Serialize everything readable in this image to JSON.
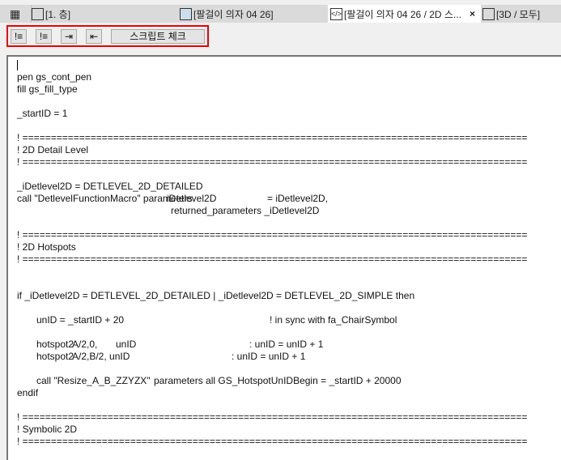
{
  "tabs": [
    {
      "label": "[1. 층]",
      "icon": "floor-plan-icon"
    },
    {
      "label": "[팔걸이 의자 04 26]",
      "icon": "object-icon"
    },
    {
      "label": "[팔걸이 의자 04 26 / 2D 스...",
      "icon": "script-icon",
      "close": "×"
    },
    {
      "label": "[3D / 모두]",
      "icon": "3d-icon"
    }
  ],
  "toolbar": {
    "script_check": "스크립트 체크"
  },
  "code": {
    "l1": "pen gs_cont_pen",
    "l2": "fill gs_fill_type",
    "l3": "_startID = 1",
    "sep": "! ==========================================================================================",
    "h1": "! 2D Detail Level",
    "l4": "_iDetlevel2D = DETLEVEL_2D_DETAILED",
    "l5a": "call \"DetlevelFunctionMacro\" parameters",
    "l5b": "iDetlevel2D",
    "l5c": "= iDetlevel2D,",
    "l6": "returned_parameters _iDetlevel2D",
    "h2": "! 2D Hotspots",
    "l7": "if _iDetlevel2D = DETLEVEL_2D_DETAILED | _iDetlevel2D = DETLEVEL_2D_SIMPLE then",
    "l8a": "unID = _startID + 20",
    "l8b": "! in sync with fa_ChairSymbol",
    "l9a": "hotspot2",
    "l9b": "A/2,0,",
    "l9c": "unID",
    "l9d": ": unID = unID + 1",
    "l10a": "hotspot2",
    "l10b": "A/2,B/2, unID",
    "l10c": ": unID = unID + 1",
    "l11a": "call \"Resize_A_B_ZZYZX\"",
    "l11b": "parameters all GS_HotspotUnIDBegin = _startID + 20000",
    "l12": "endif",
    "h3": "! Symbolic 2D"
  }
}
